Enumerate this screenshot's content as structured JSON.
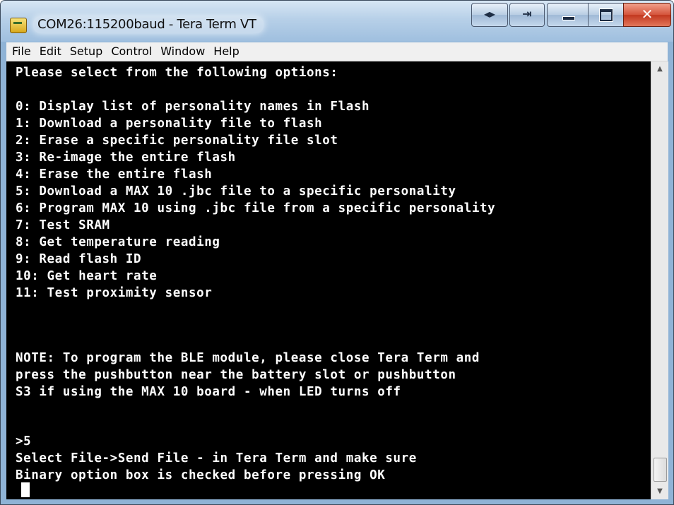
{
  "window": {
    "title": "COM26:115200baud - Tera Term VT",
    "caption_buttons": {
      "move_icon": "◂▸",
      "send_icon": "⇥",
      "close_icon": "✕"
    }
  },
  "menu": {
    "items": [
      "File",
      "Edit",
      "Setup",
      "Control",
      "Window",
      "Help"
    ]
  },
  "terminal": {
    "lines": [
      "Please select from the following options:",
      "",
      "0: Display list of personality names in Flash",
      "1: Download a personality file to flash",
      "2: Erase a specific personality file slot",
      "3: Re-image the entire flash",
      "4: Erase the entire flash",
      "5: Download a MAX 10 .jbc file to a specific personality",
      "6: Program MAX 10 using .jbc file from a specific personality",
      "7: Test SRAM",
      "8: Get temperature reading",
      "9: Read flash ID",
      "10: Get heart rate",
      "11: Test proximity sensor",
      "",
      "NOTE: To program the BLE module, please close Tera Term and",
      "press the pushbutton near the battery slot or pushbutton",
      "S3 if using the MAX 10 board - when LED turns off",
      "",
      ">5",
      "Select File->Send File - in Tera Term and make sure",
      "Binary option box is checked before pressing OK"
    ]
  },
  "scrollbar": {
    "up_arrow": "▲",
    "down_arrow": "▼"
  }
}
